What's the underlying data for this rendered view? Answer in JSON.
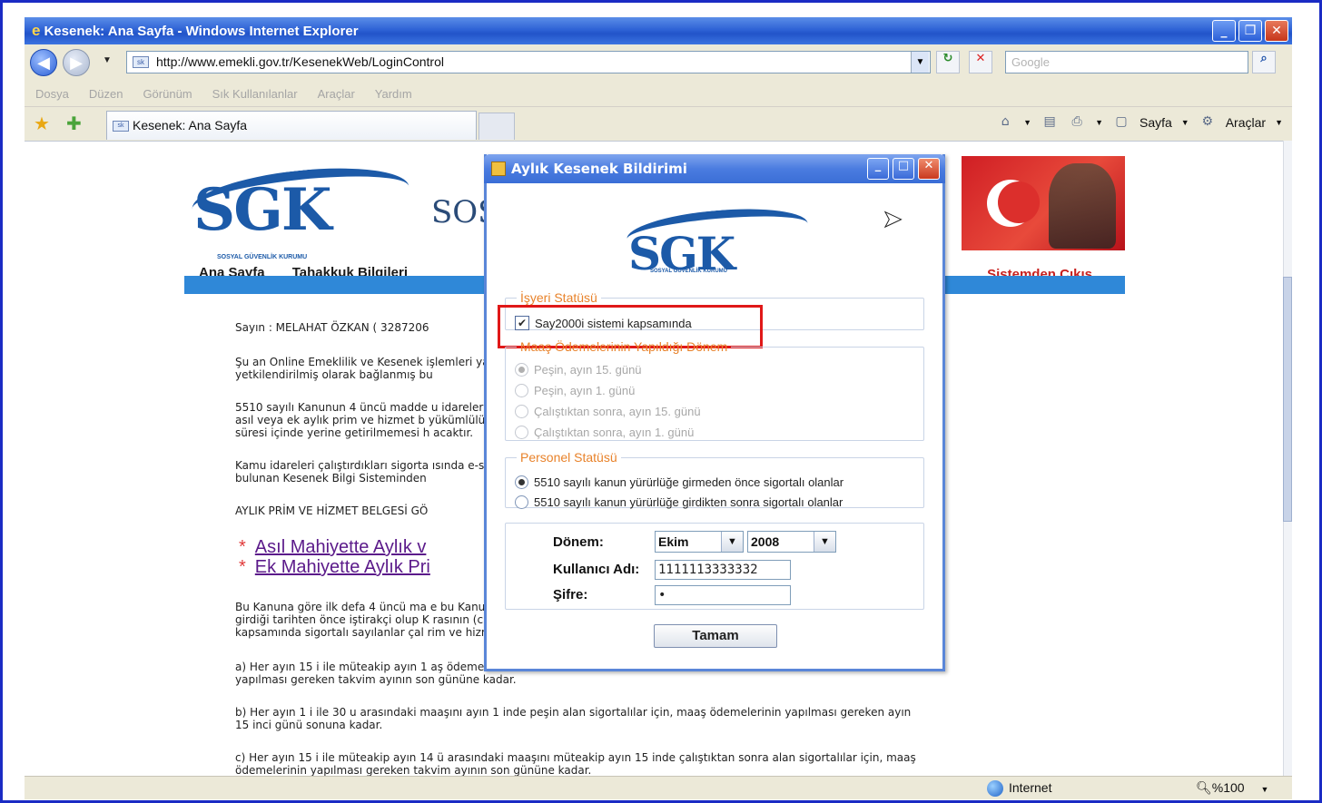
{
  "window": {
    "title": "Kesenek: Ana Sayfa - Windows Internet Explorer",
    "url": "http://www.emekli.gov.tr/KesenekWeb/LoginControl",
    "search_placeholder": "Google",
    "menu": [
      "Dosya",
      "Düzen",
      "Görünüm",
      "Sık Kullanılanlar",
      "Araçlar",
      "Yardım"
    ],
    "tab_label": "Kesenek: Ana Sayfa",
    "cmd_sayfa": "Sayfa",
    "cmd_araclar": "Araçlar",
    "status_zone": "Internet",
    "status_zoom": "%100"
  },
  "page": {
    "logo": "SGK",
    "logo_sub": "SOSYAL GÜVENLİK KURUMU",
    "partial_title": "SOS",
    "nav": [
      "Ana Sayfa",
      "Tahakkuk Bilgileri"
    ],
    "exit_link": "Sistemden Çıkış",
    "greeting": "Sayın : MELAHAT ÖZKAN ( 3287206",
    "para1": "Şu an Online Emeklilik ve Kesenek                                                                      işlemleri yapmak için\nyetkilendirilmiş olarak bağlanmış bu",
    "para2": "5510 sayılı Kanunun 4 üncü madde                                                                      u idareleri (işverenler)\nasıl veya ek aylık prim ve hizmet b                                                                       yükümlülüğün yasal\nsüresi içinde yerine getirilmemesi h                                                                      acaktır.",
    "para3": "Kamu idareleri çalıştırdıkları sigorta                                                                    ısında e-sgk bölümünde\nbulunan Kesenek Bilgi Sisteminden",
    "para4": "AYLIK PRİM VE HİZMET BELGESİ GÖ",
    "link1": "Asıl Mahiyette Aylık v",
    "link2": "Ek Mahiyette Aylık Pri",
    "para5": "Bu Kanuna göre ilk defa 4 üncü ma                                                                      e bu Kanunun yürürlüğe\ngirdiği tarihten önce iştirakçi olup K                                                                     rasının (c) bendi\nkapsamında sigortalı sayılanlar çal                                                                       rim ve hizmet belgesini;",
    "para6": "a) Her ayın 15 i ile müteakip ayın 1                                                                     aş ödemelerinin\nyapılması gereken takvim ayının son gününe kadar.",
    "para7": "b) Her ayın 1 i ile 30 u arasındaki maaşını ayın 1 inde peşin alan sigortalılar için, maaş ödemelerinin yapılması gereken ayın\n15 inci günü sonuna kadar.",
    "para8": "c) Her ayın 15 i ile müteakip ayın 14 ü arasındaki maaşını müteakip ayın 15 inde çalıştıktan sonra alan sigortalılar için, maaş\nödemelerinin yapılması gereken takvim ayının son gününe kadar."
  },
  "dialog": {
    "title": "Aylık Kesenek Bildirimi",
    "logo": "SGK",
    "logo_sub": "SOSYAL GÜVENLİK KURUMU",
    "isveren_legend": "İşyeri Statüsü",
    "say2000i_label": "Say2000i sistemi kapsamında",
    "say2000i_checked": true,
    "maas_legend": "Maaş Ödemelerinin Yapıldığı Dönem",
    "maas_options": [
      {
        "label": "Peşin, ayın 15. günü",
        "selected": true
      },
      {
        "label": "Peşin, ayın 1. günü",
        "selected": false
      },
      {
        "label": "Çalıştıktan sonra, ayın 15. günü",
        "selected": false
      },
      {
        "label": "Çalıştıktan sonra, ayın 1. günü",
        "selected": false
      }
    ],
    "personel_legend": "Personel Statüsü",
    "personel_options": [
      {
        "label": "5510 sayılı kanun yürürlüğe girmeden önce sigortalı olanlar",
        "selected": true
      },
      {
        "label": "5510 sayılı kanun yürürlüğe girdikten sonra sigortalı olanlar",
        "selected": false
      }
    ],
    "donem_label": "Dönem:",
    "month": "Ekim",
    "year": "2008",
    "user_label": "Kullanıcı Adı:",
    "username": "1111113333332",
    "password_label": "Şifre:",
    "password": "•",
    "ok_label": "Tamam"
  },
  "colors": {
    "titlebar": "#2254c9",
    "legend": "#e8822a",
    "highlight": "#e01818",
    "sgk_blue": "#1c5aa8"
  }
}
